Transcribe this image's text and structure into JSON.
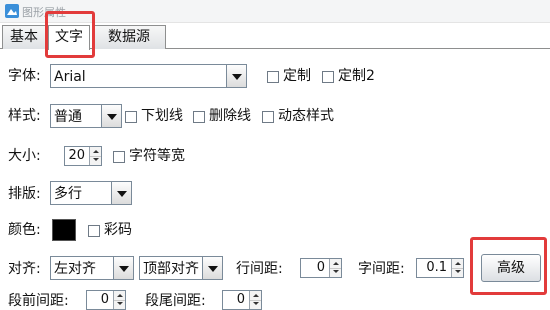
{
  "window": {
    "title": "图形属性",
    "icon": "app-icon"
  },
  "tabs": [
    {
      "label": "基本"
    },
    {
      "label": "文字",
      "active": true
    },
    {
      "label": "数据源"
    }
  ],
  "font": {
    "label": "字体:",
    "value": "Arial",
    "custom_label": "定制",
    "custom2_label": "定制2"
  },
  "style": {
    "label": "样式:",
    "value": "普通",
    "underline_label": "下划线",
    "strikethrough_label": "删除线",
    "dynamic_label": "动态样式"
  },
  "size": {
    "label": "大小:",
    "value": "20",
    "equal_width_label": "字符等宽"
  },
  "layout": {
    "label": "排版:",
    "value": "多行"
  },
  "color": {
    "label": "颜色:",
    "swatch": "#000000",
    "colorful_label": "彩码"
  },
  "align": {
    "label": "对齐:",
    "horizontal": "左对齐",
    "vertical": "顶部对齐",
    "line_spacing_label": "行间距:",
    "line_spacing_value": "0",
    "char_spacing_label": "字间距:",
    "char_spacing_value": "0.1",
    "advanced_label": "高级"
  },
  "paragraph": {
    "before_label": "段前间距:",
    "before_value": "0",
    "after_label": "段尾间距:",
    "after_value": "0"
  },
  "highlight_color": "#e23b3b"
}
